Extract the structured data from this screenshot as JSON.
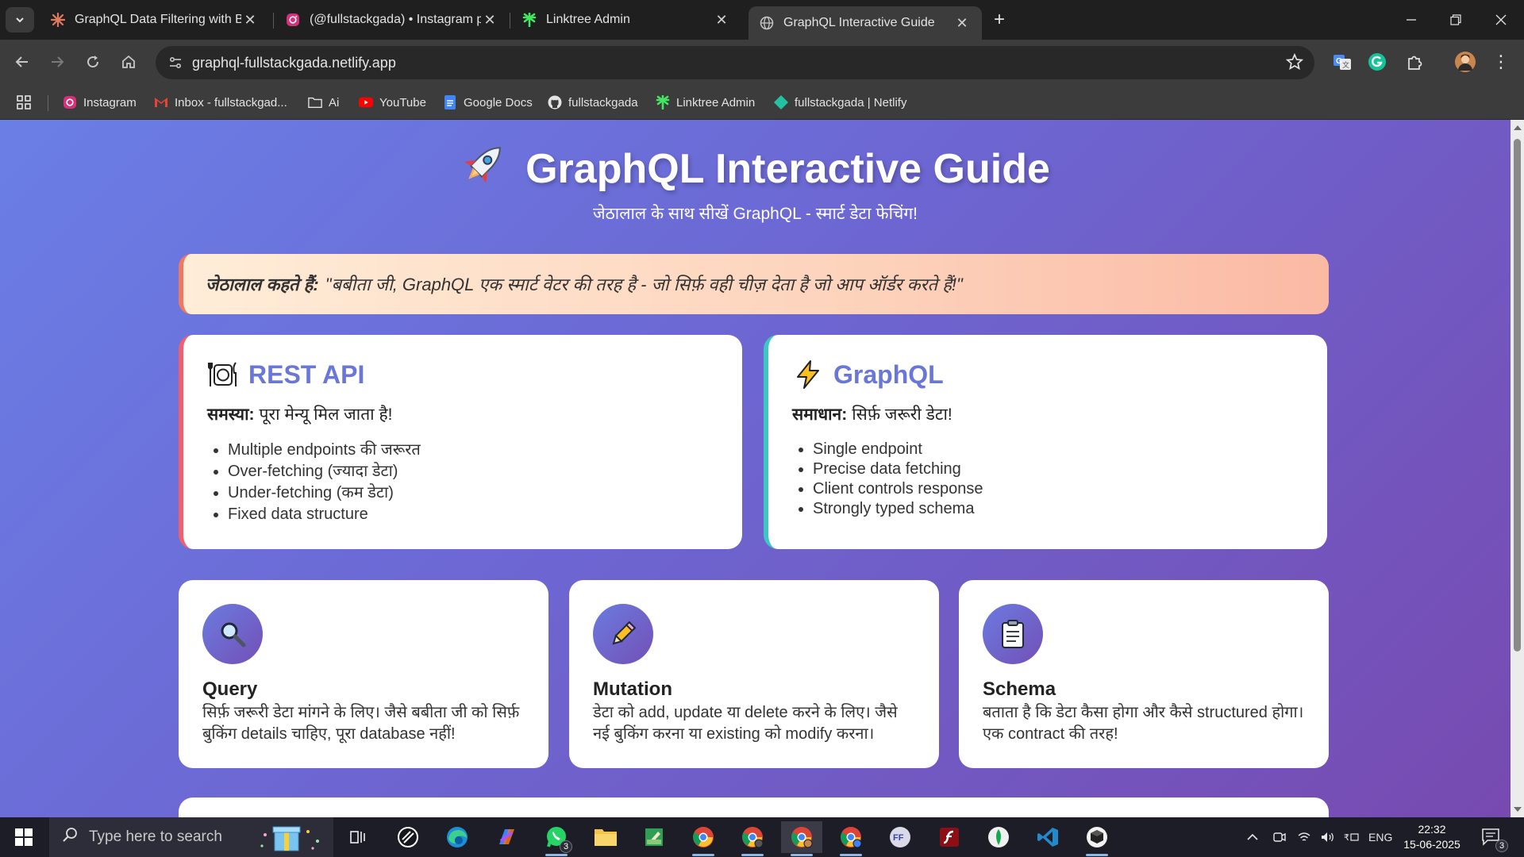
{
  "browser": {
    "tabs": [
      {
        "title": "GraphQL Data Filtering with Babita",
        "active": false
      },
      {
        "title": "(@fullstackgada) • Instagram photos",
        "active": false
      },
      {
        "title": "Linktree Admin",
        "active": false
      },
      {
        "title": "GraphQL Interactive Guide",
        "active": true
      }
    ],
    "url": "graphql-fullstackgada.netlify.app",
    "bookmarks": [
      {
        "label": "Instagram",
        "icon": "instagram-icon"
      },
      {
        "label": "Inbox - fullstackgad...",
        "icon": "gmail-icon"
      },
      {
        "label": "Ai",
        "icon": "folder-icon"
      },
      {
        "label": "YouTube",
        "icon": "youtube-icon"
      },
      {
        "label": "Google Docs",
        "icon": "google-docs-icon"
      },
      {
        "label": "fullstackgada",
        "icon": "github-icon"
      },
      {
        "label": "Linktree Admin",
        "icon": "linktree-icon"
      },
      {
        "label": "fullstackgada | Netlify",
        "icon": "netlify-icon"
      }
    ]
  },
  "page": {
    "title": "GraphQL Interactive Guide",
    "title_icon": "rocket-icon",
    "subtitle": "जेठालाल के साथ सीखें GraphQL - स्मार्ट डेटा फेचिंग!",
    "quote": {
      "speaker": "जेठालाल कहते हैं:",
      "text": "\"बबीता जी, GraphQL एक स्मार्ट वेटर की तरह है - जो सिर्फ़ वही चीज़ देता है जो आप ऑर्डर करते हैं!\""
    },
    "comparison": {
      "rest": {
        "title": "REST API",
        "icon": "restaurant-icon",
        "label": "समस्या:",
        "text": "पूरा मेन्यू मिल जाता है!",
        "points": [
          "Multiple endpoints की जरूरत",
          "Over-fetching (ज्यादा डेटा)",
          "Under-fetching (कम डेटा)",
          "Fixed data structure"
        ]
      },
      "graphql": {
        "title": "GraphQL",
        "icon": "lightning-icon",
        "label": "समाधान:",
        "text": "सिर्फ़ जरूरी डेटा!",
        "points": [
          "Single endpoint",
          "Precise data fetching",
          "Client controls response",
          "Strongly typed schema"
        ]
      }
    },
    "features": [
      {
        "title": "Query",
        "icon": "magnifier-icon",
        "desc": "सिर्फ़ जरूरी डेटा मांगने के लिए। जैसे बबीता जी को सिर्फ़ बुकिंग details चाहिए, पूरा database नहीं!"
      },
      {
        "title": "Mutation",
        "icon": "pencil-icon",
        "desc": "डेटा को add, update या delete करने के लिए। जैसे नई बुकिंग करना या existing को modify करना।"
      },
      {
        "title": "Schema",
        "icon": "clipboard-icon",
        "desc": "बताता है कि डेटा कैसा होगा और कैसे structured होगा। एक contract की तरह!"
      }
    ]
  },
  "taskbar": {
    "search_placeholder": "Type here to search",
    "whatsapp_badge": "3",
    "notification_badge": "3",
    "language": "ENG",
    "time": "22:32",
    "date": "15-06-2025"
  },
  "colors": {
    "accent": "#6877d8",
    "rest_border": "#ef5f6d",
    "graphql_border": "#3cc7c2",
    "quote_border": "#f07860"
  }
}
